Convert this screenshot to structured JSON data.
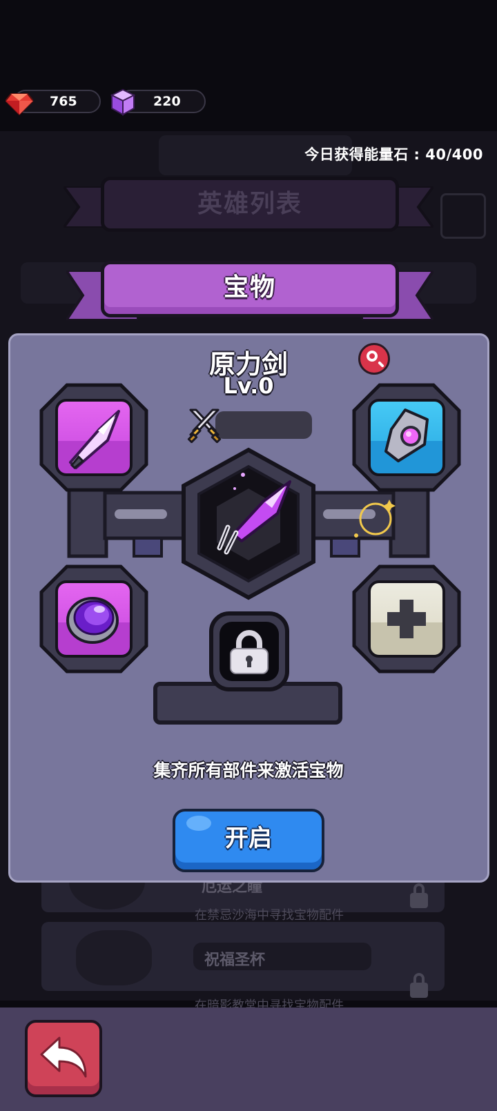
{
  "currency": {
    "ruby": {
      "icon": "ruby-gem-icon",
      "value": "765"
    },
    "cube": {
      "icon": "purple-cube-icon",
      "value": "220"
    }
  },
  "energy_text": "今日获得能量石 : 40/400",
  "background": {
    "hero_list_title": "英雄列表",
    "items": [
      {
        "name": "厄运之瞳",
        "desc": "在禁忌沙海中寻找宝物配件"
      },
      {
        "name": "祝福圣杯",
        "desc": "在暗影教堂中寻找宝物配件"
      }
    ]
  },
  "treasure_tab": "宝物",
  "treasure": {
    "name": "原力剑",
    "level": "Lv.0",
    "power_value": "",
    "hint": "集齐所有部件来激活宝物",
    "open_label": "开启",
    "parts": [
      {
        "slot": "top-left",
        "icon": "sword-blade-icon",
        "color": "#c94ee0"
      },
      {
        "slot": "top-right",
        "icon": "sword-guard-icon",
        "color": "#2fb2ea"
      },
      {
        "slot": "bottom-left",
        "icon": "purple-gem-icon",
        "color": "#c94ee0"
      },
      {
        "slot": "bottom-right",
        "icon": "plus-icon",
        "color": "#e3e0d0"
      }
    ]
  },
  "colors": {
    "panel": "#78769c",
    "tab_purple": "#b162d0",
    "open_button": "#2f8af0",
    "back_button": "#cf4358"
  }
}
